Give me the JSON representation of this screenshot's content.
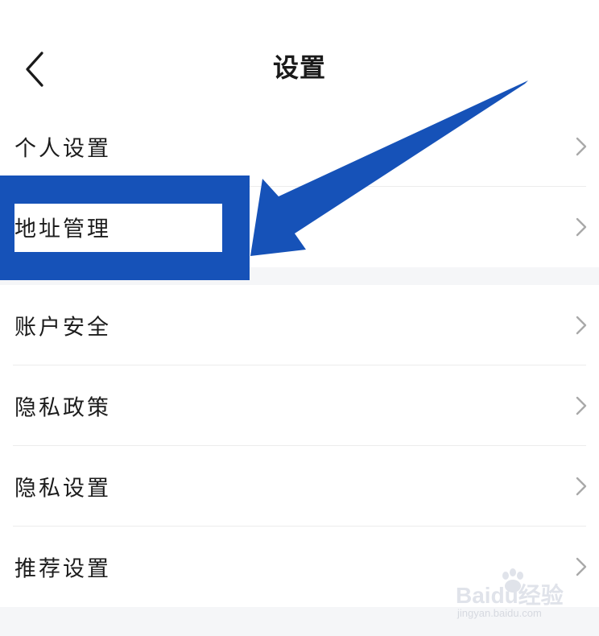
{
  "header": {
    "title": "设置",
    "back_icon": "chevron-left-icon"
  },
  "menu": {
    "group1": [
      {
        "label": "个人设置",
        "icon": "chevron-right-icon"
      },
      {
        "label": "地址管理",
        "icon": "chevron-right-icon"
      }
    ],
    "group2": [
      {
        "label": "账户安全",
        "icon": "chevron-right-icon"
      },
      {
        "label": "隐私政策",
        "icon": "chevron-right-icon"
      },
      {
        "label": "隐私设置",
        "icon": "chevron-right-icon"
      },
      {
        "label": "推荐设置",
        "icon": "chevron-right-icon"
      }
    ]
  },
  "annotation": {
    "color": "#1652b8",
    "description": "blue highlight box and arrow pointing at 地址管理"
  },
  "watermark": {
    "brand": "Baidu经验",
    "url": "jingyan.baidu.com"
  },
  "colors": {
    "background": "#ffffff",
    "group_gap": "#f5f6f8",
    "divider": "#ececec",
    "chevron": "#a9a9a9",
    "text": "#1c1c1c"
  }
}
